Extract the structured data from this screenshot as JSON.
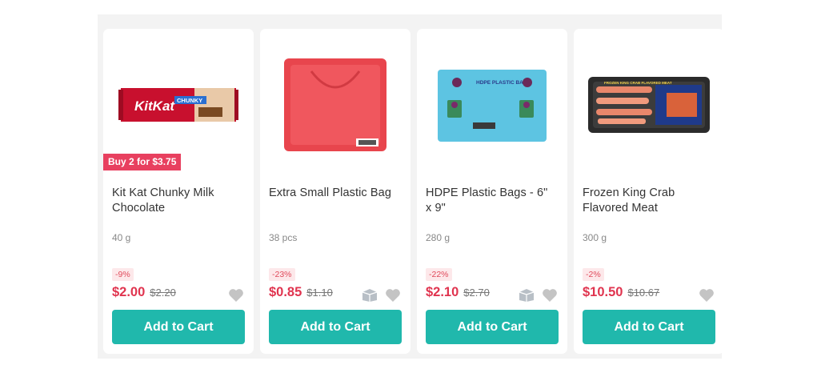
{
  "products": [
    {
      "promo": "Buy 2 for $3.75",
      "name": "Kit Kat Chunky Milk Chocolate",
      "size": "40 g",
      "discount": "-9%",
      "price": "$2.00",
      "old_price": "$2.20",
      "button": "Add to Cart",
      "image": {
        "kind": "kitkat",
        "brand_text": "KitKat",
        "sub_text": "CHUNKY"
      },
      "show_box_icon": false
    },
    {
      "name": "Extra Small Plastic Bag",
      "size": "38 pcs",
      "discount": "-23%",
      "price": "$0.85",
      "old_price": "$1.10",
      "button": "Add to Cart",
      "image": {
        "kind": "red-bag"
      },
      "show_box_icon": true
    },
    {
      "name": "HDPE Plastic Bags - 6\" x 9\"",
      "size": "280 g",
      "discount": "-22%",
      "price": "$2.10",
      "old_price": "$2.70",
      "button": "Add to Cart",
      "image": {
        "kind": "hdpe-pack",
        "label_text": "HDPE PLASTIC BAG"
      },
      "show_box_icon": true
    },
    {
      "name": "Frozen King Crab Flavored Meat",
      "size": "300 g",
      "discount": "-2%",
      "price": "$10.50",
      "old_price": "$10.67",
      "button": "Add to Cart",
      "image": {
        "kind": "crab-tray",
        "label_text": "FROZEN KING CRAB FLAVORED MEAT"
      },
      "show_box_icon": false
    }
  ],
  "colors": {
    "accent": "#20b8ac",
    "price": "#e0344f",
    "promo": "#e8405f",
    "discount_bg": "#fde8ea"
  },
  "icons": [
    "box-icon",
    "heart-icon"
  ]
}
